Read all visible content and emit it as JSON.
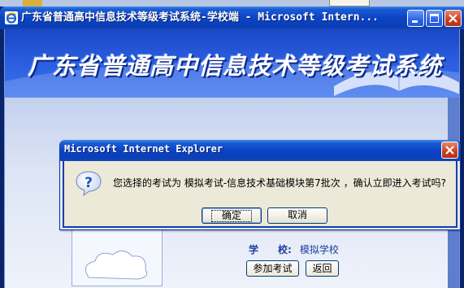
{
  "window": {
    "title": "广东省普通高中信息技术等级考试系统-学校端 - Microsoft Intern..."
  },
  "banner": {
    "title": "广东省普通高中信息技术等级考试系统"
  },
  "page": {
    "school_label": "学　　校:",
    "school_value": "模拟学校",
    "join_exam_label": "参加考试",
    "back_label": "返回"
  },
  "dialog": {
    "title": "Microsoft Internet Explorer",
    "message": "您选择的考试为 模拟考试-信息技术基础模块第7批次 ，确认立即进入考试吗?",
    "ok_label": "确定",
    "cancel_label": "取消"
  },
  "colors": {
    "title_bar": "#0b43c4",
    "dialog_bg": "#ece9d8",
    "banner_bg": "#2a5ee0",
    "close_button": "#c7401e"
  },
  "icons": {
    "app_icon": "ie-icon",
    "dialog_icon": "question-icon",
    "minimize": "minimize-icon",
    "maximize": "maximize-icon",
    "close": "close-icon"
  }
}
